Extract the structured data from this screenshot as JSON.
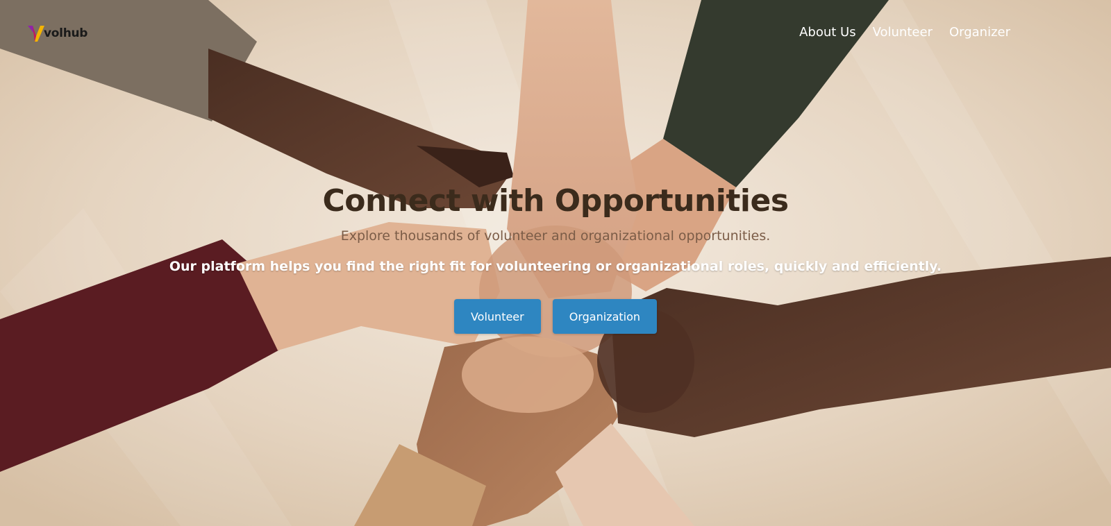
{
  "brand": {
    "name": "volhub",
    "colors": {
      "mark_primary": "#8e24aa",
      "mark_secondary": "#f4b400"
    }
  },
  "nav": {
    "links": [
      {
        "label": "About Us"
      },
      {
        "label": "Volunteer"
      },
      {
        "label": "Organizer"
      }
    ]
  },
  "hero": {
    "title": "Connect with Opportunities",
    "subtitle": "Explore thousands of volunteer and organizational opportunities.",
    "description": "Our platform helps you find the right fit for volunteering or organizational roles, quickly and efficiently.",
    "buttons": [
      {
        "label": "Volunteer"
      },
      {
        "label": "Organization"
      }
    ],
    "colors": {
      "button_bg": "#2e86c1",
      "title": "#3b2b1c",
      "subtitle": "#7b5c47"
    },
    "background_icon": "hands-stacked-photo"
  }
}
